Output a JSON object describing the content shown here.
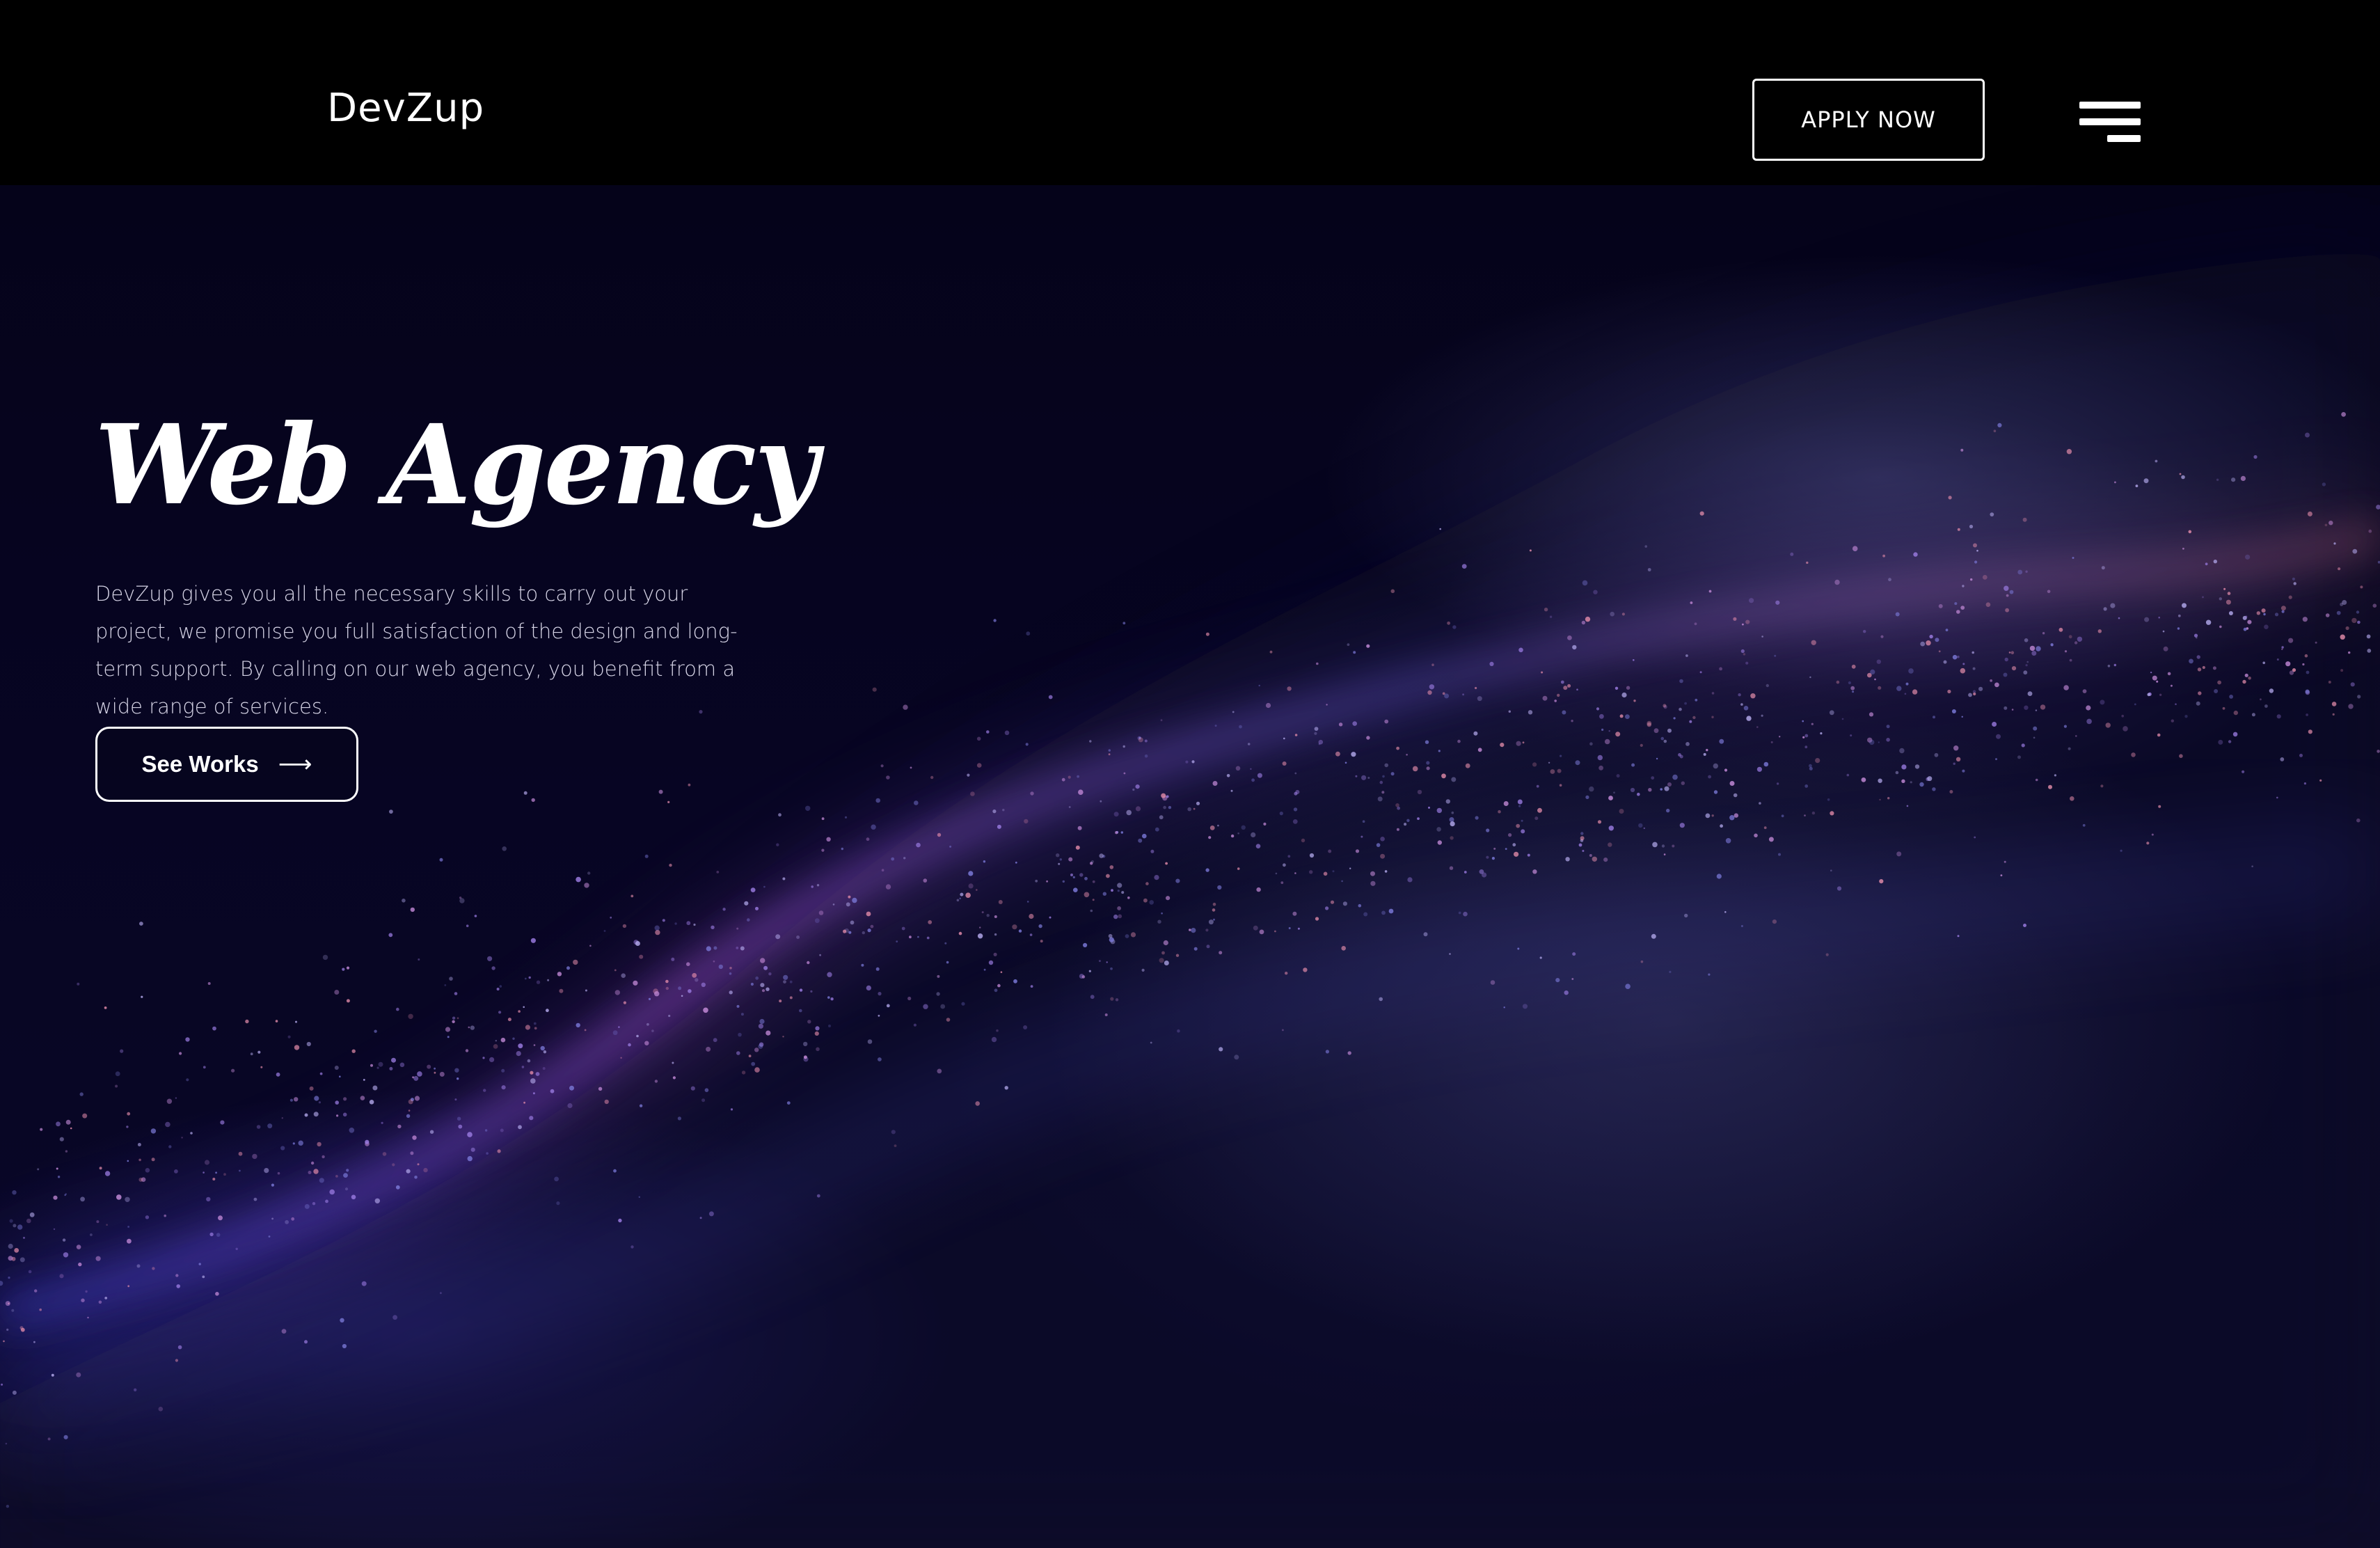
{
  "header": {
    "logo": "DevZup",
    "apply_label": "APPLY NOW",
    "menu_icon": "hamburger-menu-icon"
  },
  "hero": {
    "title": "Web Agency",
    "description": "DevZup gives you all the necessary skills to carry out your project, we promise you full satisfaction of the design and long-term support. By calling on our web agency, you benefit from a wide range of services.",
    "cta_label": "See Works",
    "cta_icon": "arrow-right-icon",
    "cta_arrow": "⟶"
  },
  "colors": {
    "header_bg": "#000000",
    "hero_bg": "#05041a",
    "wave_purple": "#9a4fc8",
    "wave_blue": "#3a3ab8",
    "text": "#ffffff"
  }
}
